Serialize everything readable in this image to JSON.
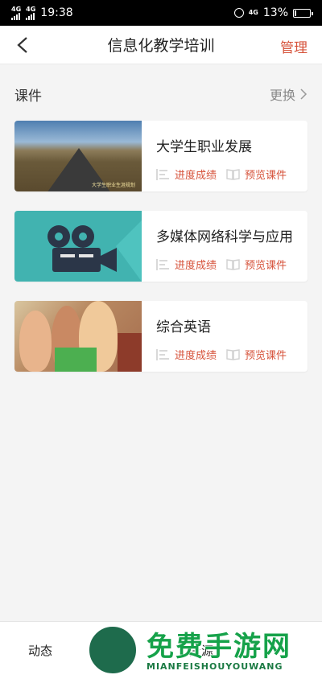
{
  "status_bar": {
    "net1": "4G",
    "net2": "4G",
    "time": "19:38",
    "net3": "4G",
    "battery": "13%",
    "battery_level": 0.13
  },
  "header": {
    "title": "信息化教学培训",
    "manage_label": "管理"
  },
  "section": {
    "label": "课件",
    "more_label": "更换"
  },
  "courses": [
    {
      "name": "大学生职业发展",
      "progress_label": "进度成绩",
      "preview_label": "预览课件",
      "thumb_caption": "大学生职业生涯规划"
    },
    {
      "name": "多媒体网络科学与应用",
      "progress_label": "进度成绩",
      "preview_label": "预览课件"
    },
    {
      "name": "综合英语",
      "progress_label": "进度成绩",
      "preview_label": "预览课件"
    }
  ],
  "tabs": [
    {
      "label": "动态"
    },
    {
      "label": ""
    },
    {
      "label": "资源"
    },
    {
      "label": ""
    }
  ],
  "watermark": {
    "main": "免费手游网",
    "sub": "MIANFEISHOUYOUWANG"
  },
  "colors": {
    "accent": "#d6523a",
    "background": "#f4f4f4"
  }
}
